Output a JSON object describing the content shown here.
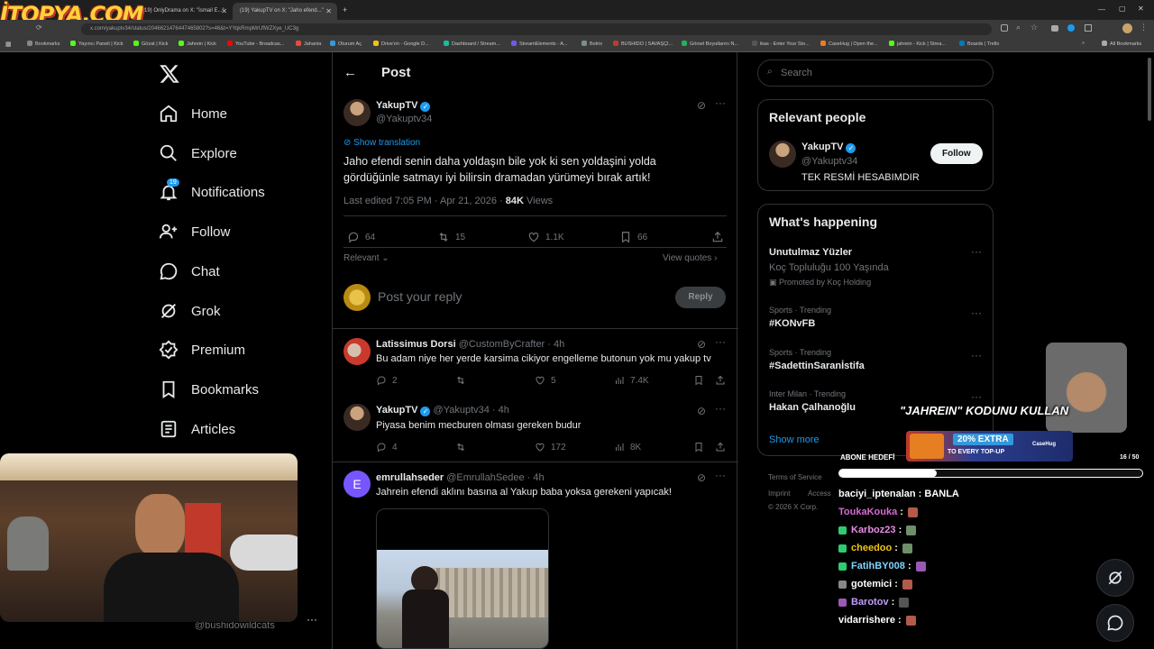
{
  "browser": {
    "tabs": [
      {
        "label": "(19) OnlyDrama on X: \"İsmail E...\"",
        "active": false
      },
      {
        "label": "(19) YakupTV on X: \"Jaho efend...\"",
        "active": true
      }
    ],
    "new_tab": "+",
    "url": "x.com/yakuptv34/status/2046621476447465802?s=46&t=YYqkRmpMrUfWZXye_UC3g",
    "bookmarks": [
      "Bookmarks",
      "Yayıncı Paneli | Kick",
      "Gözat | Kick",
      "Jahrein | Kick",
      "YouTube - Broadcas...",
      "Jahania",
      "Oturum Aç",
      "Drive'ım - Google D...",
      "Dashboard / Stream...",
      "StreamElements - A...",
      "Botrix",
      "BUSHIDO | SAVAŞÇI...",
      "Görsel Boyutlarını N...",
      "ikas - Enter Your Sto...",
      "CaseHug | Open the...",
      "jahrein - Kick | Strea...",
      "Boards | Trello"
    ],
    "all_bookmarks": "All Bookmarks",
    "overlay_logo": "İTOPYA.COM"
  },
  "nav": {
    "items": [
      {
        "label": "Home",
        "icon": "home-icon"
      },
      {
        "label": "Explore",
        "icon": "search-icon"
      },
      {
        "label": "Notifications",
        "icon": "bell-icon",
        "badge": "19"
      },
      {
        "label": "Follow",
        "icon": "add-person-icon"
      },
      {
        "label": "Chat",
        "icon": "chat-icon"
      },
      {
        "label": "Grok",
        "icon": "grok-icon"
      },
      {
        "label": "Premium",
        "icon": "premium-icon"
      },
      {
        "label": "Bookmarks",
        "icon": "bookmark-icon"
      },
      {
        "label": "Articles",
        "icon": "articles-icon"
      }
    ],
    "account_handle": "@bushidowildcats"
  },
  "post": {
    "header": "Post",
    "author_name": "YakupTV",
    "author_handle": "@Yakuptv34",
    "show_translation": "Show translation",
    "text_line1": "Jaho efendi senin daha yoldaşın bile yok ki sen yoldaşini yolda",
    "text_line2": "gördüğünle satmayı iyi bilirsin dramadan yürümeyi bırak artık!",
    "meta_edited": "Last edited 7:05 PM · Apr 21, 2026 · ",
    "views_count": "84K",
    "views_label": " Views",
    "replies": "64",
    "reposts": "15",
    "likes": "1.1K",
    "bookmarks": "66",
    "sort_label": "Relevant",
    "view_quotes": "View quotes",
    "reply_placeholder": "Post your reply",
    "reply_button": "Reply"
  },
  "replies": [
    {
      "name": "Latissimus Dorsi",
      "handle": "@CustomByCrafter · 4h",
      "text": "Bu adam niye her yerde karsima cikiyor engelleme butonun yok mu yakup tv",
      "replies": "2",
      "reposts": "",
      "likes": "5",
      "views": "7.4K"
    },
    {
      "name": "YakupTV",
      "handle": "@Yakuptv34 · 4h",
      "text": "Piyasa benim mecburen olması gereken budur",
      "replies": "4",
      "reposts": "",
      "likes": "172",
      "views": "8K"
    },
    {
      "name": "emrullahseder",
      "handle": "@EmrullahSedee · 4h",
      "text": "Jahrein efendi aklını basına al Yakup baba yoksa gerekeni yapıcak!",
      "avatar_letter": "E"
    }
  ],
  "sidebar": {
    "search_placeholder": "Search",
    "relevant_title": "Relevant people",
    "person_name": "YakupTV",
    "person_handle": "@Yakuptv34",
    "person_bio": "TEK RESMİ HESABIMDIR",
    "follow_label": "Follow",
    "happening_title": "What's happening",
    "trends": [
      {
        "title": "Unutulmaz Yüzler",
        "sub": "Koç Topluluğu 100 Yaşında",
        "promo": "Promoted by Koç Holding"
      },
      {
        "context": "Sports · Trending",
        "title": "#KONvFB"
      },
      {
        "context": "Sports · Trending",
        "title": "#SadettinSaranİstifa"
      },
      {
        "context": "Inter Milan · Trending",
        "title": "Hakan Çalhanoğlu"
      }
    ],
    "show_more": "Show more",
    "footer1": "Terms of Service",
    "footer2": "Imprint",
    "footer3": "Access",
    "copyright": "© 2026 X Corp."
  },
  "stream": {
    "promo_text": "\"JAHREIN\" KODUNU KULLAN",
    "banner_text1": "20% EXTRA",
    "banner_text2": "TO EVERY TOP-UP",
    "banner_brand": "CaseHug",
    "goal_label": "ABONE HEDEFİ",
    "goal_count": "16 / 50",
    "goal_progress": 0.32,
    "chat": [
      {
        "user": "baciyi_iptenalan",
        "color": "#ffffff",
        "msg": "BANLA",
        "badge": ""
      },
      {
        "user": "ToukaKouka",
        "color": "#d56bd3",
        "msg": "",
        "badge": ""
      },
      {
        "user": "Karboz23",
        "color": "#e88be6",
        "msg": "",
        "badge": "#2ecc71"
      },
      {
        "user": "cheedoo",
        "color": "#f1c40f",
        "msg": "",
        "badge": "#2ecc71"
      },
      {
        "user": "FatihBY008",
        "color": "#7fd4ff",
        "msg": "",
        "badge": "#2ecc71"
      },
      {
        "user": "gotemici",
        "color": "#ffffff",
        "msg": "",
        "badge": "#888888"
      },
      {
        "user": "Barotov",
        "color": "#c39bff",
        "msg": "",
        "badge": "#9b59b6"
      },
      {
        "user": "vidarrishere",
        "color": "#ffffff",
        "msg": "",
        "badge": ""
      }
    ]
  },
  "colors": {
    "accent": "#1d9bf0",
    "bg": "#000000",
    "border": "#2f3336",
    "muted": "#71767b"
  }
}
